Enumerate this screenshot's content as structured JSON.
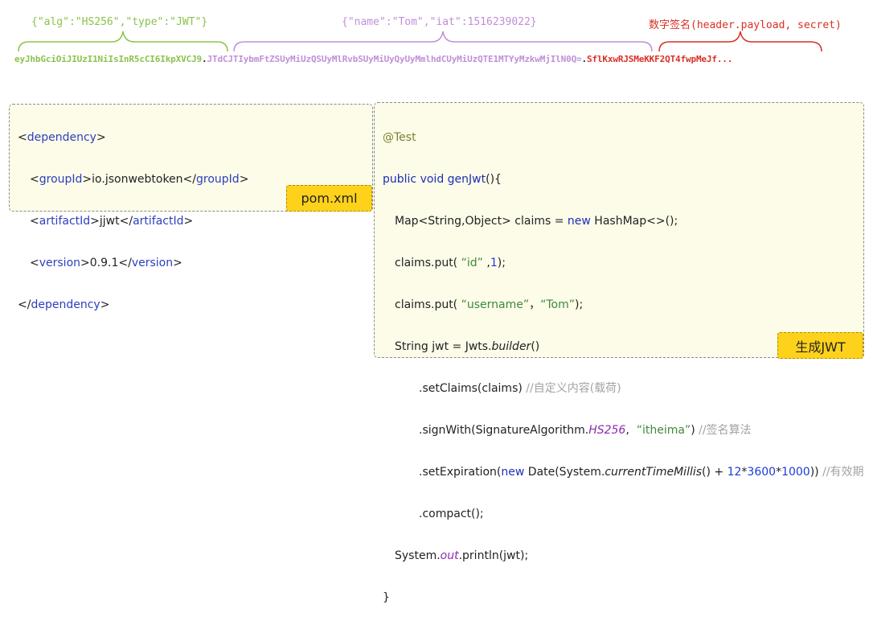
{
  "jwt": {
    "header_label": "{\"alg\":\"HS256\",\"type\":\"JWT\"}",
    "payload_label": "{\"name\":\"Tom\",\"iat\":1516239022}",
    "signature_label": "数字签名(header.payload, secret)",
    "header_token": "eyJhbGciOiJIUzI1NiIsInR5cCI6IkpXVCJ9",
    "dot": ".",
    "payload_token": "JTdCJTIybmFtZSUyMiUzQSUyMlRvbSUyMiUyQyUyMmlhdCUyMiUzQTE1MTYyMzkwMjIlN0Q=",
    "signature_token": "SflKxwRJSMeKKF2QT4fwpMeJf...",
    "colors": {
      "header": "#8bc34a",
      "payload": "#c08fd8",
      "signature": "#d93025"
    }
  },
  "pom": {
    "open_tag": "dependency",
    "group_tag": "groupId",
    "group_value": "io.jsonwebtoken",
    "artifact_tag": "artifactId",
    "artifact_value": "jjwt",
    "version_tag": "version",
    "version_value": "0.9.1",
    "label": "pom.xml"
  },
  "code": {
    "annotation": "@Test",
    "kw_public": "public",
    "kw_void": "void",
    "method_name": "genJwt",
    "method_tail": "(){",
    "map_decl_a": "Map<String,Object> claims = ",
    "kw_new": "new",
    "map_decl_b": " HashMap<>();",
    "put1_a": "claims.put(",
    "put1_key": "“id”",
    "put1_num": "1",
    "put1_b": ");",
    "put2_a": "claims.put(",
    "put2_key": "“username”",
    "put2_comma": "，",
    "put2_val": "“Tom”",
    "put2_b": ");",
    "jwt_decl": "String jwt = Jwts.",
    "builder": "builder",
    "parens": "()",
    "set_claims": ".setClaims(claims) ",
    "comment_claims": "//自定义内容(载荷)",
    "sign_a": ".signWith(SignatureAlgorithm.",
    "hs256": "HS256",
    "sign_comma": ",",
    "sign_key": "“itheima”",
    "sign_b": ") ",
    "comment_sign": "//签名算法",
    "exp_a": ".setExpiration(",
    "exp_b": " Date(System.",
    "current_time": "currentTimeMillis",
    "exp_c": "() + ",
    "n12": "12",
    "star": "*",
    "n3600": "3600",
    "n1000": "1000",
    "exp_d": ")) ",
    "comment_exp": "//有效期",
    "compact": ".compact();",
    "sysout_a": "System.",
    "out": "out",
    "sysout_b": ".println(jwt);",
    "close": "}",
    "label": "生成JWT"
  }
}
